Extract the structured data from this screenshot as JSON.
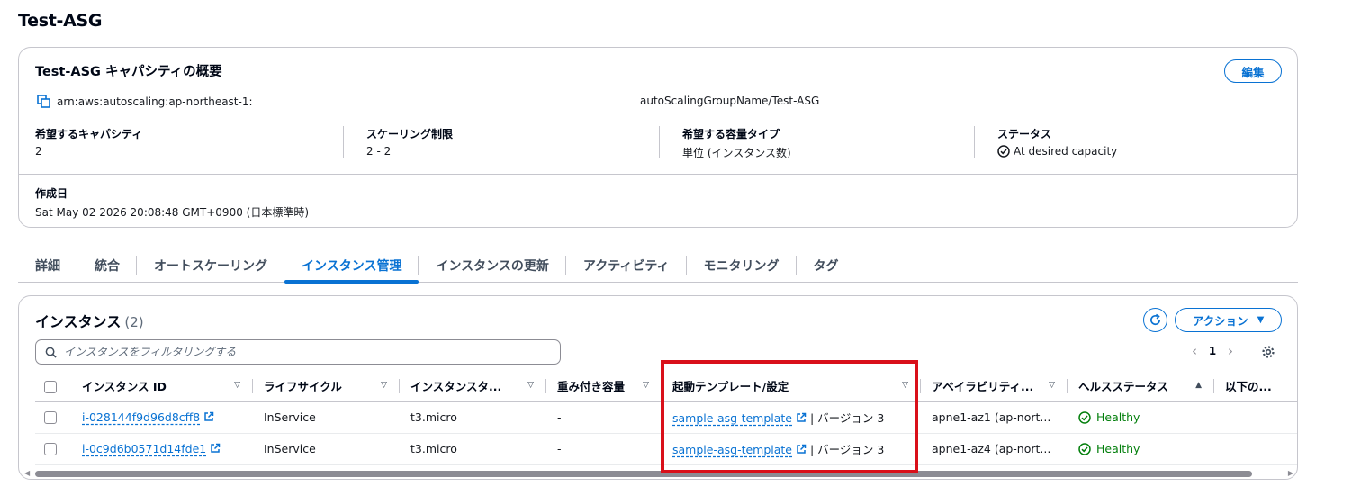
{
  "page_title": "Test-ASG",
  "summary": {
    "title": "Test-ASG キャパシティの概要",
    "edit_label": "編集",
    "arn": "arn:aws:autoscaling:ap-northeast-1:",
    "arn_suffix": "autoScalingGroupName/Test-ASG",
    "fields": [
      {
        "key": "希望するキャパシティ",
        "value": "2"
      },
      {
        "key": "スケーリング制限",
        "value": "2 - 2"
      },
      {
        "key": "希望する容量タイプ",
        "value": "単位 (インスタンス数)"
      },
      {
        "key": "ステータス",
        "value": "At desired capacity"
      }
    ],
    "created_key": "作成日",
    "created_value": "Sat May 02 2026 20:08:48 GMT+0900 (日本標準時)"
  },
  "tabs": [
    {
      "label": "詳細"
    },
    {
      "label": "統合"
    },
    {
      "label": "オートスケーリング"
    },
    {
      "label": "インスタンス管理"
    },
    {
      "label": "インスタンスの更新"
    },
    {
      "label": "アクティビティ"
    },
    {
      "label": "モニタリング"
    },
    {
      "label": "タグ"
    }
  ],
  "active_tab": "インスタンス管理",
  "instances": {
    "title": "インスタンス",
    "count": "(2)",
    "action_label": "アクション",
    "search_placeholder": "インスタンスをフィルタリングする",
    "page_number": "1",
    "columns": [
      "インスタンス ID",
      "ライフサイクル",
      "インスタンスタ...",
      "重み付き容量",
      "起動テンプレート/設定",
      "アベイラビリティ...",
      "ヘルスステータス",
      "以下の..."
    ],
    "rows": [
      {
        "id": "i-028144f9d96d8cff8",
        "lifecycle": "InService",
        "type": "t3.micro",
        "weight": "-",
        "template": "sample-asg-template",
        "version": "| バージョン 3",
        "az": "apne1-az1 (ap-nort...",
        "health": "Healthy"
      },
      {
        "id": "i-0c9d6b0571d14fde1",
        "lifecycle": "InService",
        "type": "t3.micro",
        "weight": "-",
        "template": "sample-asg-template",
        "version": "| バージョン 3",
        "az": "apne1-az4 (ap-nort...",
        "health": "Healthy"
      }
    ]
  },
  "colors": {
    "accent": "#0972d3",
    "success": "#037f0c",
    "highlight": "#d9101a"
  }
}
